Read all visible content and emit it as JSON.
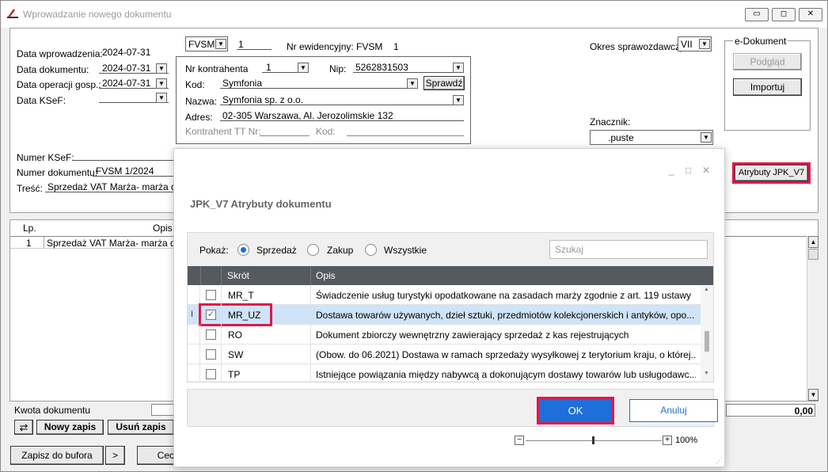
{
  "window": {
    "title": "Wprowadzanie nowego dokumentu",
    "min_glyph": "▭",
    "max_glyph": "◻",
    "close_glyph": "✕"
  },
  "form": {
    "data_wprowadzenia_label": "Data wprowadzenia:",
    "data_wprowadzenia": "2024-07-31",
    "data_dokumentu_label": "Data dokumentu:",
    "data_dokumentu": "2024-07-31",
    "data_operacji_label": "Data operacji gosp.:",
    "data_operacji": "2024-07-31",
    "data_ksef_label": "Data KSeF:",
    "doc_type": "FVSM",
    "doc_number_small": "1",
    "nr_ewid_label": "Nr ewidencyjny: FVSM",
    "nr_ewid_value": "1",
    "nr_kontrahenta_label": "Nr kontrahenta",
    "nr_kontrahenta": "1",
    "nip_label": "Nip:",
    "nip": "5262831503",
    "kod_label": "Kod:",
    "kod": "Symfonia",
    "sprawdz_label": "Sprawdź",
    "nazwa_label": "Nazwa:",
    "nazwa": "Symfonia sp. z o.o.",
    "adres_label": "Adres:",
    "adres": "02-305 Warszawa, Al. Jerozolimskie 132",
    "kontrahent_tt_label": "Kontrahent TT Nr:",
    "kod2_label": "Kod:",
    "okres_label": "Okres sprawozdawczy:",
    "okres": "VII",
    "edokument_label": "e-Dokument",
    "podglad_label": "Podgląd",
    "importuj_label": "Importuj",
    "znacznik_label": "Znacznik:",
    "znacznik": ".puste",
    "atrybuty_label": "Atrybuty JPK_V7",
    "numer_ksef_label": "Numer KSeF:",
    "numer_dok_label": "Numer dokumentu:",
    "numer_dok": "FVSM 1/2024",
    "tresc_label": "Treść:",
    "tresc": "Sprzedaż VAT Marża- marża doda"
  },
  "grid": {
    "col_lp": "Lp.",
    "col_opis": "Opis",
    "row_lp": "1",
    "row_opis": "Sprzedaż VAT Marża- marża doda"
  },
  "bottom": {
    "kwota_label": "Kwota dokumentu",
    "kwota_value": "0,00",
    "nowy_zapis": "Nowy zapis",
    "usun_zapis": "Usuń zapis",
    "zapisz_bufora": "Zapisz do bufora",
    "arrow": ">",
    "cec": "Cec"
  },
  "dialog": {
    "title": "JPK_V7 Atrybuty dokumentu",
    "pokaz_label": "Pokaż:",
    "radio_sprzedaz": "Sprzedaż",
    "radio_zakup": "Zakup",
    "radio_wszystkie": "Wszystkie",
    "selected_radio": "Sprzedaż",
    "search_placeholder": "Szukaj",
    "col_skrot": "Skrót",
    "col_opis": "Opis",
    "rows": [
      {
        "code": "MR_T",
        "desc": "Świadczenie usług turystyki opodatkowane na zasadach marży zgodnie z art. 119 ustawy",
        "checked": false
      },
      {
        "code": "MR_UZ",
        "desc": "Dostawa towarów używanych, dzieł sztuki, przedmiotów kolekcjonerskich i antyków, opo...",
        "checked": true
      },
      {
        "code": "RO",
        "desc": "Dokument zbiorczy wewnętrzny zawierający sprzedaż z kas rejestrujących",
        "checked": false
      },
      {
        "code": "SW",
        "desc": "(Obow. do 06.2021) Dostawa w ramach sprzedaży wysyłkowej z terytorium kraju, o której...",
        "checked": false
      },
      {
        "code": "TP",
        "desc": "Istniejące powiązania między nabywcą a dokonującym dostawy towarów lub usługodawc...",
        "checked": false
      }
    ],
    "ok_label": "OK",
    "cancel_label": "Anuluj",
    "zoom": "100%",
    "zoom_minus": "−",
    "zoom_plus": "+",
    "cursor_glyph": "I"
  },
  "colors": {
    "accent": "#1e6fd9",
    "highlight": "#e0174c",
    "header": "#555a61"
  }
}
